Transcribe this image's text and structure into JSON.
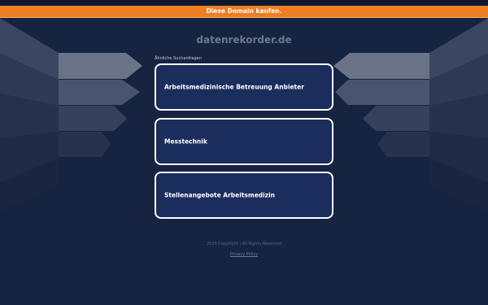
{
  "banner": {
    "label": "Diese Domain kaufen."
  },
  "domain": {
    "name": "datenrekorder.de"
  },
  "related": {
    "heading": "Ähnliche Suchanfragen",
    "links": [
      "Arbeitsmedizinische Betreuung Anbieter",
      "Messtechnik",
      "Stellenangebote Arbeitsmedizin"
    ]
  },
  "footer": {
    "copyright": "2025 Copyright | All Rights Reserved",
    "privacy": "Privacy Policy"
  },
  "colors": {
    "background": "#162341",
    "banner": "#ef7d21",
    "box_fill": "#1b2d5c",
    "box_border": "#ffffff"
  }
}
